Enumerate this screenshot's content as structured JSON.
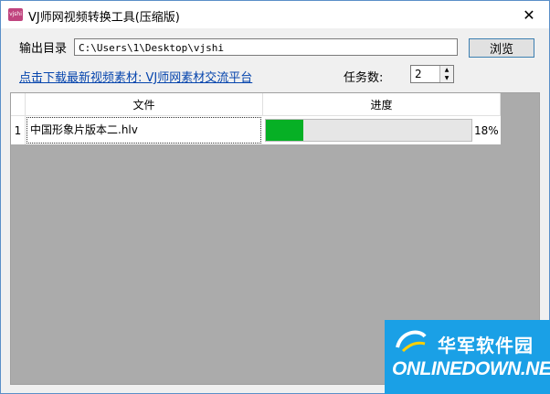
{
  "window": {
    "title": "VJ师网视频转换工具(压缩版)",
    "icon": "app-logo-icon",
    "close": "✕"
  },
  "output": {
    "label": "输出目录",
    "path": "C:\\Users\\1\\Desktop\\vjshi",
    "browse": "浏览"
  },
  "link": {
    "text": "点击下载最新视频素材: VJ师网素材交流平台"
  },
  "tasks": {
    "label": "任务数:",
    "value": "2"
  },
  "table": {
    "columns": [
      "文件",
      "进度"
    ],
    "rows": [
      {
        "index": "1",
        "file": "中国形象片版本二.hlv",
        "progress_percent": 18,
        "progress_text": "18%"
      }
    ]
  },
  "watermark": {
    "cn": "华军软件园",
    "en": "ONLINEDOWN.NET"
  },
  "colors": {
    "progress": "#06b025",
    "link": "#0645ad",
    "watermark_bg": "#1aa0e6"
  }
}
